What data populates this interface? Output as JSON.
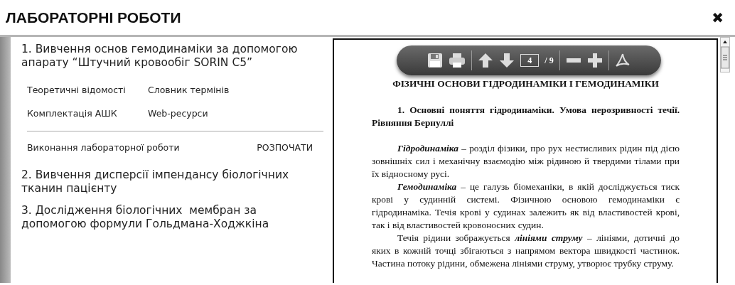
{
  "window": {
    "title": "ЛАБОРАТОРНІ РОБОТИ",
    "close": "✖"
  },
  "labs": [
    {
      "title": "1. Вивчення основ гемодинаміки за допомогою апарату “Штучний кровообіг SORIN C5”",
      "links": [
        "Теоретичні відомості",
        "Словник термінів",
        "Комплектація АШК",
        "Web-ресурси"
      ],
      "task": {
        "label": "Виконання лабораторної роботи",
        "button": "РОЗПОЧАТИ"
      }
    },
    {
      "title": "2. Вивчення дисперсії імпендансу біологічних тканин пацієнту"
    },
    {
      "title": "3. Дослідження біологічних  мембран за допомогою формули Гольдмана-Ходжкіна"
    }
  ],
  "viewer": {
    "page": "4",
    "total": "/ 9",
    "heading": "ФІЗИЧНІ ОСНОВИ ГІДРОДИНАМІКИ І ГЕМОДИНАМІКИ",
    "section": "1. Основні поняття гідродинаміки. Умова нерозривності течії. Рівняння Бернуллі",
    "paragraphs": [
      "**Гідродинаміка** – розділ фізики, про рух нестисливих рідин під дією зовнішніх сил і механічну взаємодію між рідиною й твердими тілами при їх відносному русі.",
      "**Гемодинаміка** – це галузь біомеханіки, в якій досліджується тиск крові у судинній системі. Фізичною основою гемодинаміки є гідродинаміка. Течія крові у судинах залежить як від властивостей крові, так і від властивостей кровоносних судин.",
      "Течія рідини зображується **лініями струму** – лініями, дотичні до яких в кожній точці збігаються з напрямом вектора швидкості частинок. Частина потоку рідини, обмежена лініями струму, утворює трубку струму."
    ]
  }
}
